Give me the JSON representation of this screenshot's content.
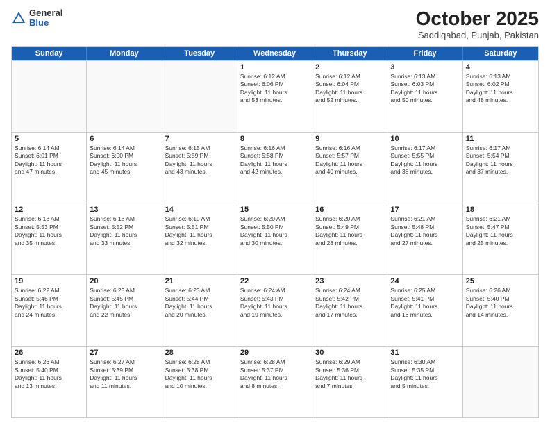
{
  "header": {
    "logo_general": "General",
    "logo_blue": "Blue",
    "month_title": "October 2025",
    "location": "Saddiqabad, Punjab, Pakistan"
  },
  "weekdays": [
    "Sunday",
    "Monday",
    "Tuesday",
    "Wednesday",
    "Thursday",
    "Friday",
    "Saturday"
  ],
  "rows": [
    [
      {
        "day": "",
        "lines": []
      },
      {
        "day": "",
        "lines": []
      },
      {
        "day": "",
        "lines": []
      },
      {
        "day": "1",
        "lines": [
          "Sunrise: 6:12 AM",
          "Sunset: 6:06 PM",
          "Daylight: 11 hours",
          "and 53 minutes."
        ]
      },
      {
        "day": "2",
        "lines": [
          "Sunrise: 6:12 AM",
          "Sunset: 6:04 PM",
          "Daylight: 11 hours",
          "and 52 minutes."
        ]
      },
      {
        "day": "3",
        "lines": [
          "Sunrise: 6:13 AM",
          "Sunset: 6:03 PM",
          "Daylight: 11 hours",
          "and 50 minutes."
        ]
      },
      {
        "day": "4",
        "lines": [
          "Sunrise: 6:13 AM",
          "Sunset: 6:02 PM",
          "Daylight: 11 hours",
          "and 48 minutes."
        ]
      }
    ],
    [
      {
        "day": "5",
        "lines": [
          "Sunrise: 6:14 AM",
          "Sunset: 6:01 PM",
          "Daylight: 11 hours",
          "and 47 minutes."
        ]
      },
      {
        "day": "6",
        "lines": [
          "Sunrise: 6:14 AM",
          "Sunset: 6:00 PM",
          "Daylight: 11 hours",
          "and 45 minutes."
        ]
      },
      {
        "day": "7",
        "lines": [
          "Sunrise: 6:15 AM",
          "Sunset: 5:59 PM",
          "Daylight: 11 hours",
          "and 43 minutes."
        ]
      },
      {
        "day": "8",
        "lines": [
          "Sunrise: 6:16 AM",
          "Sunset: 5:58 PM",
          "Daylight: 11 hours",
          "and 42 minutes."
        ]
      },
      {
        "day": "9",
        "lines": [
          "Sunrise: 6:16 AM",
          "Sunset: 5:57 PM",
          "Daylight: 11 hours",
          "and 40 minutes."
        ]
      },
      {
        "day": "10",
        "lines": [
          "Sunrise: 6:17 AM",
          "Sunset: 5:55 PM",
          "Daylight: 11 hours",
          "and 38 minutes."
        ]
      },
      {
        "day": "11",
        "lines": [
          "Sunrise: 6:17 AM",
          "Sunset: 5:54 PM",
          "Daylight: 11 hours",
          "and 37 minutes."
        ]
      }
    ],
    [
      {
        "day": "12",
        "lines": [
          "Sunrise: 6:18 AM",
          "Sunset: 5:53 PM",
          "Daylight: 11 hours",
          "and 35 minutes."
        ]
      },
      {
        "day": "13",
        "lines": [
          "Sunrise: 6:18 AM",
          "Sunset: 5:52 PM",
          "Daylight: 11 hours",
          "and 33 minutes."
        ]
      },
      {
        "day": "14",
        "lines": [
          "Sunrise: 6:19 AM",
          "Sunset: 5:51 PM",
          "Daylight: 11 hours",
          "and 32 minutes."
        ]
      },
      {
        "day": "15",
        "lines": [
          "Sunrise: 6:20 AM",
          "Sunset: 5:50 PM",
          "Daylight: 11 hours",
          "and 30 minutes."
        ]
      },
      {
        "day": "16",
        "lines": [
          "Sunrise: 6:20 AM",
          "Sunset: 5:49 PM",
          "Daylight: 11 hours",
          "and 28 minutes."
        ]
      },
      {
        "day": "17",
        "lines": [
          "Sunrise: 6:21 AM",
          "Sunset: 5:48 PM",
          "Daylight: 11 hours",
          "and 27 minutes."
        ]
      },
      {
        "day": "18",
        "lines": [
          "Sunrise: 6:21 AM",
          "Sunset: 5:47 PM",
          "Daylight: 11 hours",
          "and 25 minutes."
        ]
      }
    ],
    [
      {
        "day": "19",
        "lines": [
          "Sunrise: 6:22 AM",
          "Sunset: 5:46 PM",
          "Daylight: 11 hours",
          "and 24 minutes."
        ]
      },
      {
        "day": "20",
        "lines": [
          "Sunrise: 6:23 AM",
          "Sunset: 5:45 PM",
          "Daylight: 11 hours",
          "and 22 minutes."
        ]
      },
      {
        "day": "21",
        "lines": [
          "Sunrise: 6:23 AM",
          "Sunset: 5:44 PM",
          "Daylight: 11 hours",
          "and 20 minutes."
        ]
      },
      {
        "day": "22",
        "lines": [
          "Sunrise: 6:24 AM",
          "Sunset: 5:43 PM",
          "Daylight: 11 hours",
          "and 19 minutes."
        ]
      },
      {
        "day": "23",
        "lines": [
          "Sunrise: 6:24 AM",
          "Sunset: 5:42 PM",
          "Daylight: 11 hours",
          "and 17 minutes."
        ]
      },
      {
        "day": "24",
        "lines": [
          "Sunrise: 6:25 AM",
          "Sunset: 5:41 PM",
          "Daylight: 11 hours",
          "and 16 minutes."
        ]
      },
      {
        "day": "25",
        "lines": [
          "Sunrise: 6:26 AM",
          "Sunset: 5:40 PM",
          "Daylight: 11 hours",
          "and 14 minutes."
        ]
      }
    ],
    [
      {
        "day": "26",
        "lines": [
          "Sunrise: 6:26 AM",
          "Sunset: 5:40 PM",
          "Daylight: 11 hours",
          "and 13 minutes."
        ]
      },
      {
        "day": "27",
        "lines": [
          "Sunrise: 6:27 AM",
          "Sunset: 5:39 PM",
          "Daylight: 11 hours",
          "and 11 minutes."
        ]
      },
      {
        "day": "28",
        "lines": [
          "Sunrise: 6:28 AM",
          "Sunset: 5:38 PM",
          "Daylight: 11 hours",
          "and 10 minutes."
        ]
      },
      {
        "day": "29",
        "lines": [
          "Sunrise: 6:28 AM",
          "Sunset: 5:37 PM",
          "Daylight: 11 hours",
          "and 8 minutes."
        ]
      },
      {
        "day": "30",
        "lines": [
          "Sunrise: 6:29 AM",
          "Sunset: 5:36 PM",
          "Daylight: 11 hours",
          "and 7 minutes."
        ]
      },
      {
        "day": "31",
        "lines": [
          "Sunrise: 6:30 AM",
          "Sunset: 5:35 PM",
          "Daylight: 11 hours",
          "and 5 minutes."
        ]
      },
      {
        "day": "",
        "lines": []
      }
    ]
  ]
}
